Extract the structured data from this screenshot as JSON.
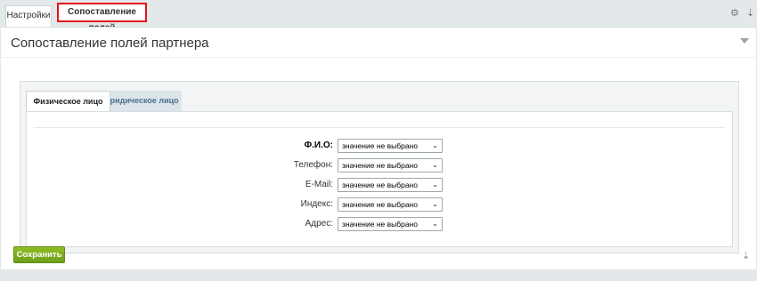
{
  "top_tabs": [
    {
      "label": "Настройки"
    },
    {
      "label": "Сопоставление полей"
    }
  ],
  "toolbar": {
    "gear_icon": "⚙",
    "pin_icon": "⇣"
  },
  "panel": {
    "title": "Сопоставление полей партнера"
  },
  "inner_tabs": [
    {
      "label": "Физическое лицо",
      "active": true
    },
    {
      "label": "Юридическое лицо",
      "active": false
    }
  ],
  "fields": [
    {
      "label": "Ф.И.О:",
      "value": "значение не выбрано"
    },
    {
      "label": "Телефон:",
      "value": "значение не выбрано"
    },
    {
      "label": "E-Mail:",
      "value": "значение не выбрано"
    },
    {
      "label": "Индекс:",
      "value": "значение не выбрано"
    },
    {
      "label": "Адрес:",
      "value": "значение не выбрано"
    }
  ],
  "actions": {
    "save_label": "Сохранить"
  },
  "colors": {
    "highlight": "#e3141b",
    "save_button": "#7aad1f",
    "inactive_tab_text": "#4a6f8a"
  }
}
